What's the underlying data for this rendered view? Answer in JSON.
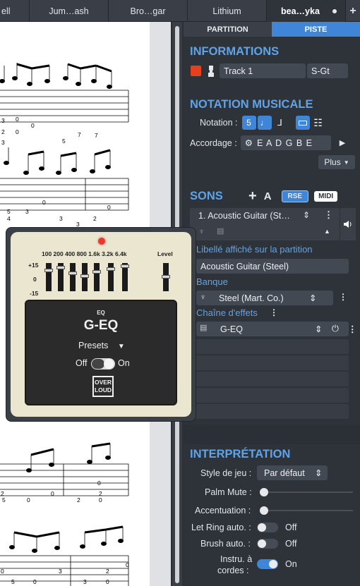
{
  "tabs": [
    "ell",
    "Jum…ash",
    "Bro…gar",
    "Lithium",
    "bea…yka",
    "+"
  ],
  "panel_tabs": [
    "PARTITION",
    "PISTE"
  ],
  "informations": {
    "title": "INFORMATIONS",
    "color": "#e8401c",
    "track_name": "Track 1",
    "track_short": "S-Gt"
  },
  "notation": {
    "title": "NOTATION MUSICALE",
    "notation_label": "Notation :",
    "notation_icons": [
      "5",
      "♩",
      "⅃"
    ],
    "tuning_label": "Accordage :",
    "tuning_value": "E A D G B E",
    "plus_label": "Plus"
  },
  "sons": {
    "title": "SONS",
    "add": "+",
    "a": "A",
    "rse": "RSE",
    "midi": "MIDI",
    "instrument": "1. Acoustic Guitar (St…",
    "label_caption": "Libellé affiché sur la partition",
    "label_value": "Acoustic Guitar (Steel)",
    "bank_caption": "Banque",
    "bank_value": "Steel (Mart.  Co.)",
    "chain_caption": "Chaîne d'effets",
    "effect_value": "G-EQ"
  },
  "eq": {
    "freqs": "100 200 400 800 1.6k 3.2k 6.4k",
    "level": "Level",
    "db_top": "+15",
    "db_mid": "0",
    "db_bot": "-15",
    "section": "EQ",
    "name": "G-EQ",
    "presets": "Presets",
    "off": "Off",
    "on": "On",
    "brand1": "OVER",
    "brand2": "LOUD",
    "bypass_on": true
  },
  "interpretation": {
    "title": "INTERPRÉTATION",
    "style_label": "Style de jeu :",
    "style_value": "Par défaut",
    "palm_label": "Palm Mute :",
    "palm_value": 0,
    "accent_label": "Accentuation :",
    "accent_value": 0,
    "letring_label": "Let Ring auto. :",
    "letring_value": "Off",
    "brush_label": "Brush auto. :",
    "brush_value": "Off",
    "instru_label1": "Instru. à",
    "instru_label2": "cordes :",
    "instru_value": "On"
  },
  "tab_numbers": {
    "sys1": [
      "3",
      "0",
      "0",
      "2",
      "0",
      "7",
      "3",
      "5",
      "7"
    ],
    "sys2": [
      "0",
      "5",
      "3",
      "4",
      "3",
      "0",
      "2",
      "3"
    ],
    "sys3": [
      "0",
      "2",
      "0",
      "2",
      "5",
      "0",
      "2",
      "0"
    ],
    "sys4": [
      "0",
      "2",
      "3",
      "0",
      "5",
      "0",
      "3",
      "0"
    ]
  }
}
